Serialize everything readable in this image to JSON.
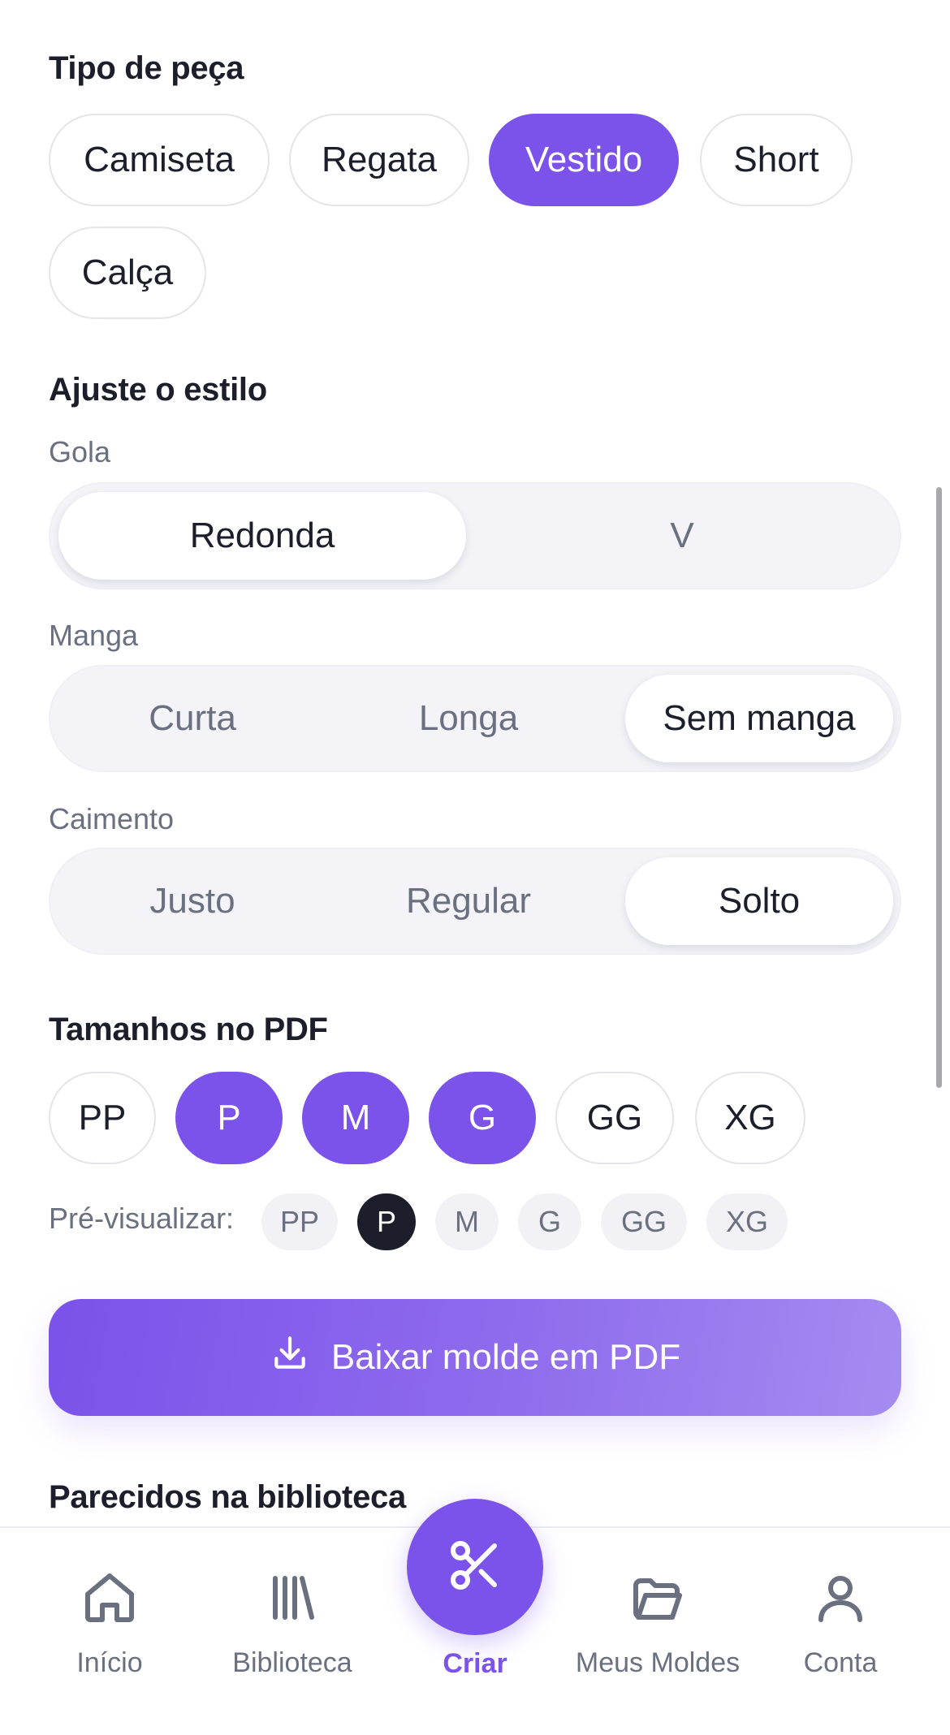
{
  "piece_type": {
    "title": "Tipo de peça",
    "options": [
      "Camiseta",
      "Regata",
      "Vestido",
      "Short",
      "Calça"
    ],
    "selected": "Vestido"
  },
  "style": {
    "title": "Ajuste o estilo",
    "gola": {
      "label": "Gola",
      "options": [
        "Redonda",
        "V"
      ],
      "selected": "Redonda"
    },
    "manga": {
      "label": "Manga",
      "options": [
        "Curta",
        "Longa",
        "Sem manga"
      ],
      "selected": "Sem manga"
    },
    "caimento": {
      "label": "Caimento",
      "options": [
        "Justo",
        "Regular",
        "Solto"
      ],
      "selected": "Solto"
    }
  },
  "sizes": {
    "title": "Tamanhos no PDF",
    "options": [
      "PP",
      "P",
      "M",
      "G",
      "GG",
      "XG"
    ],
    "selected": [
      "P",
      "M",
      "G"
    ]
  },
  "preview": {
    "label": "Pré-visualizar:",
    "options": [
      "PP",
      "P",
      "M",
      "G",
      "GG",
      "XG"
    ],
    "selected": "P"
  },
  "download_button": {
    "label": "Baixar molde em PDF",
    "icon": "download-icon"
  },
  "similar": {
    "title": "Parecidos na biblioteca"
  },
  "nav": {
    "items": [
      {
        "label": "Início",
        "icon": "home-icon"
      },
      {
        "label": "Biblioteca",
        "icon": "library-icon"
      },
      {
        "label": "Criar",
        "icon": "scissors-icon"
      },
      {
        "label": "Meus Moldes",
        "icon": "folder-icon"
      },
      {
        "label": "Conta",
        "icon": "user-icon"
      }
    ],
    "active": "Criar"
  },
  "colors": {
    "accent": "#7b52ea",
    "text": "#1c1f2b",
    "muted": "#6b7080",
    "segment_bg": "#f3f3f8"
  }
}
